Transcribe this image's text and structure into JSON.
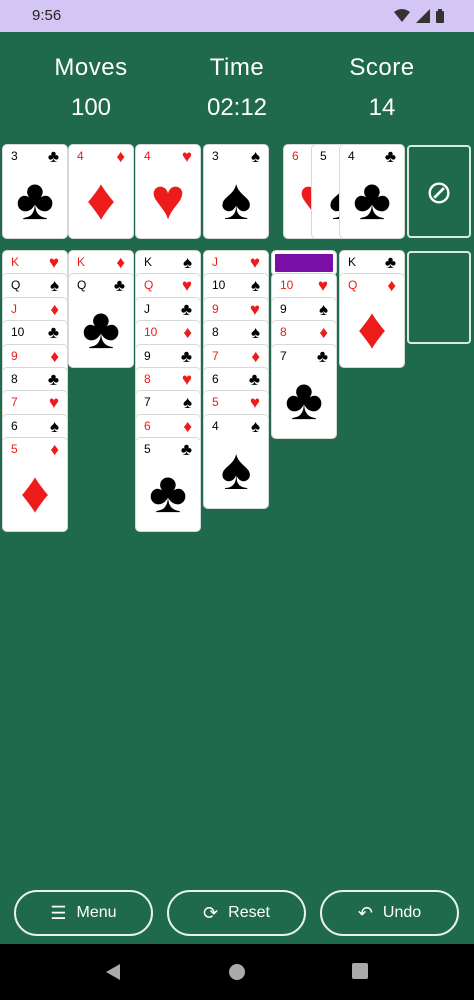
{
  "status": {
    "time": "9:56"
  },
  "stats": {
    "moves_label": "Moves",
    "moves_value": "100",
    "time_label": "Time",
    "time_value": "02:12",
    "score_label": "Score",
    "score_value": "14"
  },
  "foundations": [
    {
      "rank": "3",
      "suit": "♣",
      "color": "black"
    },
    {
      "rank": "4",
      "suit": "♦",
      "color": "red"
    },
    {
      "rank": "4",
      "suit": "♥",
      "color": "red"
    },
    {
      "rank": "3",
      "suit": "♠",
      "color": "black"
    }
  ],
  "waste": [
    {
      "rank": "6",
      "suit": "♥",
      "color": "red"
    },
    {
      "rank": "5",
      "suit": "♠",
      "color": "black"
    },
    {
      "rank": "4",
      "suit": "♣",
      "color": "black"
    }
  ],
  "stock_icon": "⊘",
  "tableau": [
    [
      {
        "rank": "K",
        "suit": "♥",
        "color": "red"
      },
      {
        "rank": "Q",
        "suit": "♠",
        "color": "black"
      },
      {
        "rank": "J",
        "suit": "♦",
        "color": "red"
      },
      {
        "rank": "10",
        "suit": "♣",
        "color": "black"
      },
      {
        "rank": "9",
        "suit": "♦",
        "color": "red"
      },
      {
        "rank": "8",
        "suit": "♣",
        "color": "black"
      },
      {
        "rank": "7",
        "suit": "♥",
        "color": "red"
      },
      {
        "rank": "6",
        "suit": "♠",
        "color": "black"
      },
      {
        "rank": "5",
        "suit": "♦",
        "color": "red"
      }
    ],
    [
      {
        "rank": "K",
        "suit": "♦",
        "color": "red"
      },
      {
        "rank": "Q",
        "suit": "♣",
        "color": "black"
      }
    ],
    [
      {
        "rank": "K",
        "suit": "♠",
        "color": "black"
      },
      {
        "rank": "Q",
        "suit": "♥",
        "color": "red"
      },
      {
        "rank": "J",
        "suit": "♣",
        "color": "black"
      },
      {
        "rank": "10",
        "suit": "♦",
        "color": "red"
      },
      {
        "rank": "9",
        "suit": "♣",
        "color": "black"
      },
      {
        "rank": "8",
        "suit": "♥",
        "color": "red"
      },
      {
        "rank": "7",
        "suit": "♠",
        "color": "black"
      },
      {
        "rank": "6",
        "suit": "♦",
        "color": "red"
      },
      {
        "rank": "5",
        "suit": "♣",
        "color": "black"
      }
    ],
    [
      {
        "rank": "J",
        "suit": "♥",
        "color": "red"
      },
      {
        "rank": "10",
        "suit": "♠",
        "color": "black"
      },
      {
        "rank": "9",
        "suit": "♥",
        "color": "red"
      },
      {
        "rank": "8",
        "suit": "♠",
        "color": "black"
      },
      {
        "rank": "7",
        "suit": "♦",
        "color": "red"
      },
      {
        "rank": "6",
        "suit": "♣",
        "color": "black"
      },
      {
        "rank": "5",
        "suit": "♥",
        "color": "red"
      },
      {
        "rank": "4",
        "suit": "♠",
        "color": "black"
      }
    ],
    [
      {
        "rank": "10",
        "suit": "♥",
        "color": "red"
      },
      {
        "rank": "9",
        "suit": "♠",
        "color": "black"
      },
      {
        "rank": "8",
        "suit": "♦",
        "color": "red"
      },
      {
        "rank": "7",
        "suit": "♣",
        "color": "black"
      }
    ],
    [
      {
        "rank": "K",
        "suit": "♣",
        "color": "black"
      },
      {
        "rank": "Q",
        "suit": "♦",
        "color": "red"
      }
    ]
  ],
  "buttons": {
    "menu": "Menu",
    "reset": "Reset",
    "undo": "Undo"
  },
  "colors": {
    "felt": "#1f6a4c",
    "red": "#ee1b1b",
    "facedown": "#7a0fa8"
  }
}
